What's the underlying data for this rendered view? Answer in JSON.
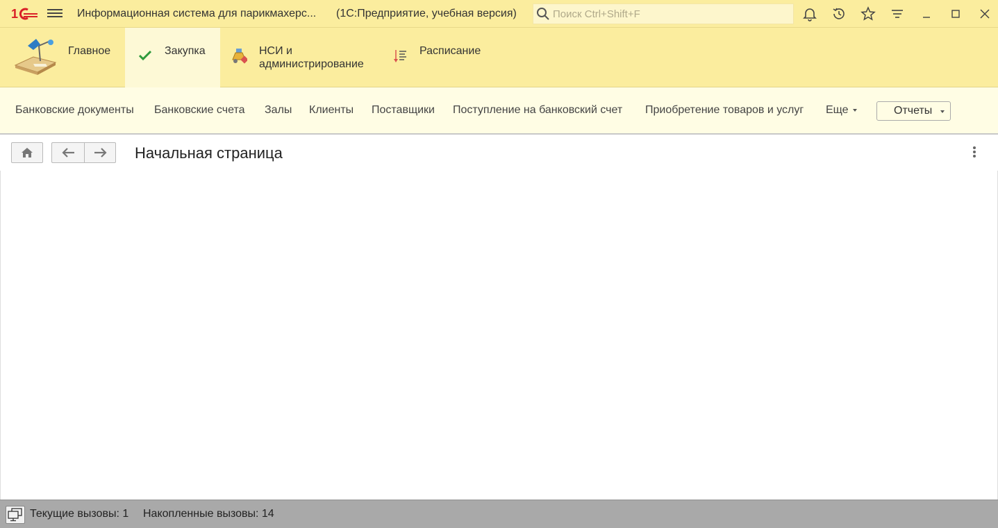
{
  "window": {
    "title": "Информационная система для парикмахерс...",
    "subtitle": "(1С:Предприятие, учебная версия)"
  },
  "search": {
    "placeholder": "Поиск Ctrl+Shift+F"
  },
  "sections": [
    {
      "label": "Главное",
      "icon": "desk-lamp-icon",
      "active": false
    },
    {
      "label": "Закупка",
      "icon": "checkmark-icon",
      "active": true
    },
    {
      "label_line1": "НСИ и",
      "label_line2": "администрирование",
      "icon": "flask-settings-icon",
      "active": false
    },
    {
      "label": "Расписание",
      "icon": "sort-list-icon",
      "active": false
    }
  ],
  "commands": [
    "Банковские документы",
    "Банковские счета",
    "Залы",
    "Клиенты",
    "Поставщики",
    "Поступление на банковский счет",
    "Приобретение товаров и услуг"
  ],
  "more_label": "Еще",
  "reports_label": "Отчеты",
  "page": {
    "title": "Начальная страница"
  },
  "status": {
    "current_calls": "Текущие вызовы: 1",
    "accumulated_calls": "Накопленные вызовы: 14"
  },
  "colors": {
    "header_bg": "#fbed9e",
    "active_section_bg": "#fdf9d6",
    "command_bar_bg": "#fffde4",
    "statusbar_bg": "#a9a9a9",
    "logo_red": "#d92027"
  }
}
